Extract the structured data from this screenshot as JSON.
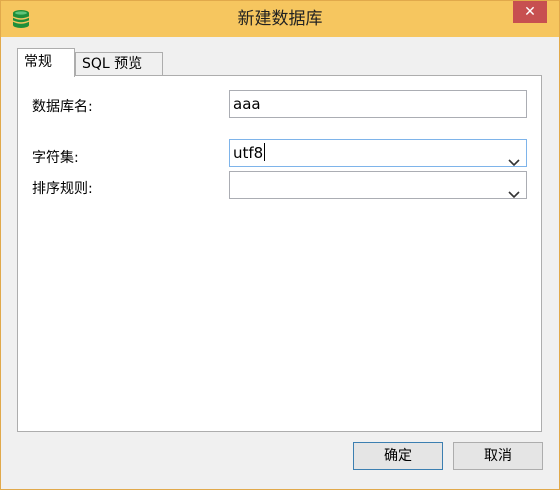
{
  "window": {
    "title": "新建数据库",
    "close_symbol": "✕",
    "app_icon": "database-icon",
    "titlebar_color": "#f6c65f",
    "close_color": "#c75050"
  },
  "tabs": [
    {
      "label": "常规",
      "active": true
    },
    {
      "label": "SQL 预览",
      "active": false
    }
  ],
  "form": {
    "db_name": {
      "label": "数据库名:",
      "value": "aaa"
    },
    "charset": {
      "label": "字符集:",
      "value": "utf8"
    },
    "collation": {
      "label": "排序规则:",
      "value": ""
    }
  },
  "buttons": {
    "ok": "确定",
    "cancel": "取消"
  }
}
